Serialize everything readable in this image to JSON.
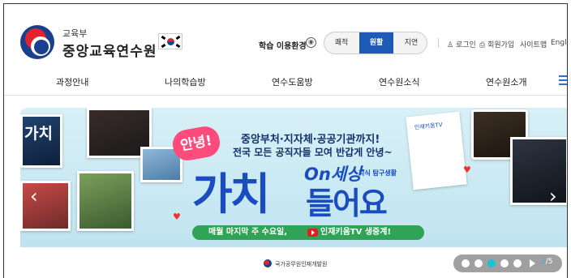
{
  "header": {
    "ministry": "교육부",
    "institute": "중앙교육연수원"
  },
  "env": {
    "label": "학습 이용환경",
    "options": [
      "쾌적",
      "원활",
      "지연"
    ],
    "selected": "원활"
  },
  "util_links": [
    "로그인",
    "회원가입",
    "사이트맵",
    "English"
  ],
  "nav": [
    "과정안내",
    "나의학습방",
    "연수도움방",
    "연수원소식",
    "연수원소개"
  ],
  "banner": {
    "badge": "안녕!",
    "line1": "중앙부처·지자체·공공기관까지!",
    "line2": "전국 모든 공직자들 모여 반갑게 안녕~",
    "big1": "가치",
    "on": "On세상",
    "on_sub": "지식 탐구생활",
    "big2": "들어요",
    "pill_text1": "매월 마지막 주 수요일,",
    "pill_text2": "인재키움TV 생중계!",
    "photo_left_text": "가치",
    "tv_label": "인재키움TV",
    "org": "국가공무원인재개발원"
  },
  "slider": {
    "current": "3",
    "total": "/5"
  },
  "colors": {
    "accent": "#1f5bb6",
    "nav_icon": "#2d6fd0",
    "pager_active": "#19c4d4",
    "pill": "#2fa457"
  }
}
